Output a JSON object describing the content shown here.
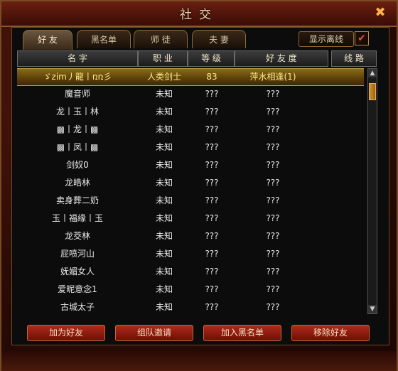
{
  "window": {
    "title": "社交",
    "close_label": "✖"
  },
  "tabs": [
    {
      "label": "好 友"
    },
    {
      "label": "黑名单"
    },
    {
      "label": "师 徒"
    },
    {
      "label": "夫 妻"
    }
  ],
  "toggle": {
    "label": "显示离线",
    "checked": true,
    "mark": "✔"
  },
  "columns": [
    "名 字",
    "职 业",
    "等 级",
    "好 友 度",
    "线 路"
  ],
  "rows": [
    {
      "name": "ゞzim丿龍丨ռռ彡",
      "job": "人类剑士",
      "level": "83",
      "intimacy": "萍水相逢(1)",
      "line": ""
    },
    {
      "name": "魔音师",
      "job": "未知",
      "level": "???",
      "intimacy": "???",
      "line": ""
    },
    {
      "name": "龙丨玉丨林",
      "job": "未知",
      "level": "???",
      "intimacy": "???",
      "line": ""
    },
    {
      "name": "▩丨龙丨▩",
      "job": "未知",
      "level": "???",
      "intimacy": "???",
      "line": ""
    },
    {
      "name": "▩丨凤丨▩",
      "job": "未知",
      "level": "???",
      "intimacy": "???",
      "line": ""
    },
    {
      "name": "剑奴0",
      "job": "未知",
      "level": "???",
      "intimacy": "???",
      "line": ""
    },
    {
      "name": "龙皓林",
      "job": "未知",
      "level": "???",
      "intimacy": "???",
      "line": ""
    },
    {
      "name": "卖身葬二奶",
      "job": "未知",
      "level": "???",
      "intimacy": "???",
      "line": ""
    },
    {
      "name": "玉丨福缘丨玉",
      "job": "未知",
      "level": "???",
      "intimacy": "???",
      "line": ""
    },
    {
      "name": "龙茭林",
      "job": "未知",
      "level": "???",
      "intimacy": "???",
      "line": ""
    },
    {
      "name": "屁喷河山",
      "job": "未知",
      "level": "???",
      "intimacy": "???",
      "line": ""
    },
    {
      "name": "妩媚女人",
      "job": "未知",
      "level": "???",
      "intimacy": "???",
      "line": ""
    },
    {
      "name": "爱昵意念1",
      "job": "未知",
      "level": "???",
      "intimacy": "???",
      "line": ""
    },
    {
      "name": "古城太子",
      "job": "未知",
      "level": "???",
      "intimacy": "???",
      "line": ""
    }
  ],
  "buttons": {
    "add_friend": "加为好友",
    "team_invite": "组队邀请",
    "add_blacklist": "加入黑名单",
    "remove_friend": "移除好友"
  },
  "scrollbar": {
    "up": "▲",
    "down": "▼"
  }
}
